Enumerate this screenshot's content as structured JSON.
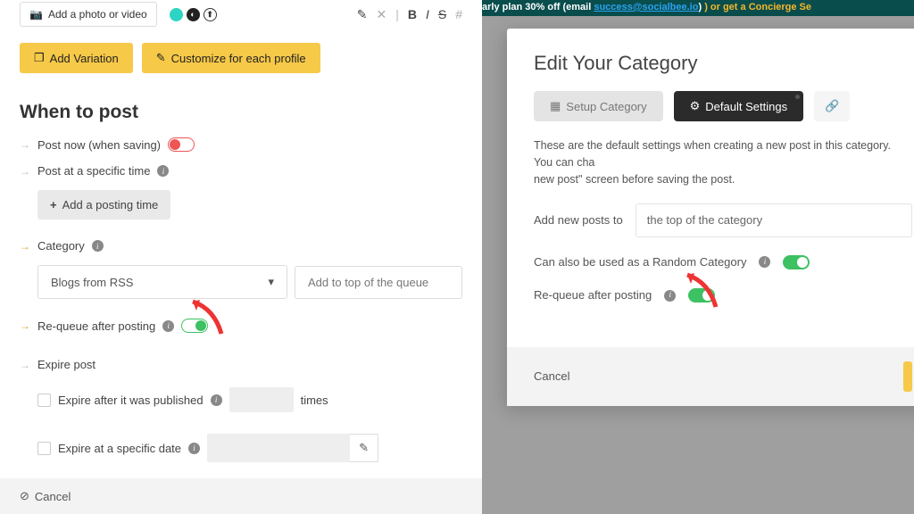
{
  "toolbar": {
    "add_media": "Add a photo or video",
    "add_variation": "Add Variation",
    "customize": "Customize for each profile"
  },
  "section": {
    "when_to_post": "When to post",
    "post_now": "Post now (when saving)",
    "post_specific": "Post at a specific time",
    "add_posting_time": "Add a posting time",
    "category_label": "Category",
    "category_value": "Blogs from RSS",
    "queue_position": "Add to top of the queue",
    "requeue": "Re-queue after posting",
    "expire_post": "Expire post",
    "expire_after": "Expire after it was published",
    "times": "times",
    "expire_date": "Expire at a specific date"
  },
  "footer": {
    "cancel": "Cancel"
  },
  "banner": {
    "text1": "arly plan 30% off (email ",
    "email": "success@socialbee.io",
    "text2": ") or get a Concierge Se"
  },
  "modal": {
    "title": "Edit Your Category",
    "tab_setup": "Setup Category",
    "tab_defaults": "Default Settings",
    "desc": "These are the default settings when creating a new post in this category. You can cha",
    "desc2": "new post\" screen before saving the post.",
    "add_posts_label": "Add new posts to",
    "add_posts_value": "the top of the category",
    "random_label": "Can also be used as a Random Category",
    "requeue_label": "Re-queue after posting",
    "cancel": "Cancel"
  }
}
